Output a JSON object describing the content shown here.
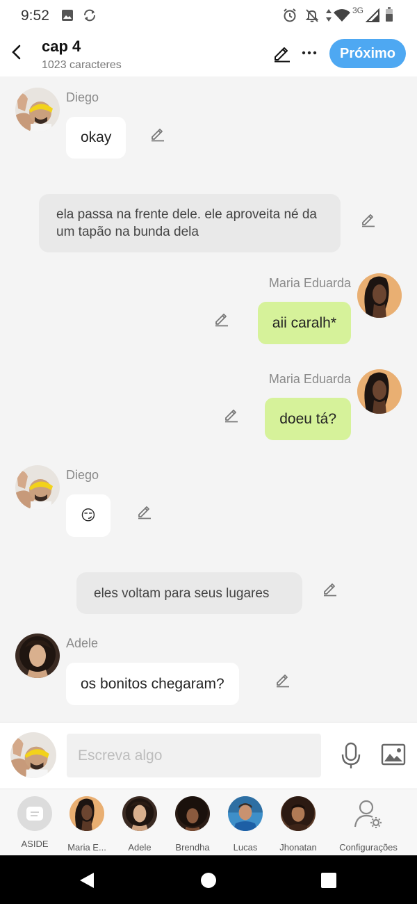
{
  "status_bar": {
    "time": "9:52",
    "network": "3G"
  },
  "header": {
    "title": "cap 4",
    "subtitle": "1023 caracteres",
    "next_label": "Próximo",
    "accent_color": "#4ea8f2"
  },
  "messages": [
    {
      "type": "character",
      "side": "left",
      "name": "Diego",
      "text": "okay"
    },
    {
      "type": "narration",
      "text": "ela passa na frente dele. ele aproveita né da um tapão na bunda dela"
    },
    {
      "type": "character",
      "side": "right",
      "name": "Maria Eduarda",
      "text": "aii caralh*"
    },
    {
      "type": "character",
      "side": "right",
      "name": "Maria Eduarda",
      "text": "doeu tá?"
    },
    {
      "type": "character",
      "side": "left",
      "name": "Diego",
      "text": "😏"
    },
    {
      "type": "narration",
      "text": "eles voltam para seus lugares"
    },
    {
      "type": "character",
      "side": "left",
      "name": "Adele",
      "text": "os bonitos chegaram?"
    }
  ],
  "input": {
    "placeholder": "Escreva algo"
  },
  "characters": [
    {
      "label": "ASIDE"
    },
    {
      "label": "Maria E..."
    },
    {
      "label": "Adele"
    },
    {
      "label": "Brendha"
    },
    {
      "label": "Lucas"
    },
    {
      "label": "Jhonatan"
    },
    {
      "label": "Configurações"
    }
  ],
  "colors": {
    "right_bubble": "#d6f29a",
    "left_bubble": "#ffffff",
    "narration_bubble": "#e9e9e9"
  }
}
